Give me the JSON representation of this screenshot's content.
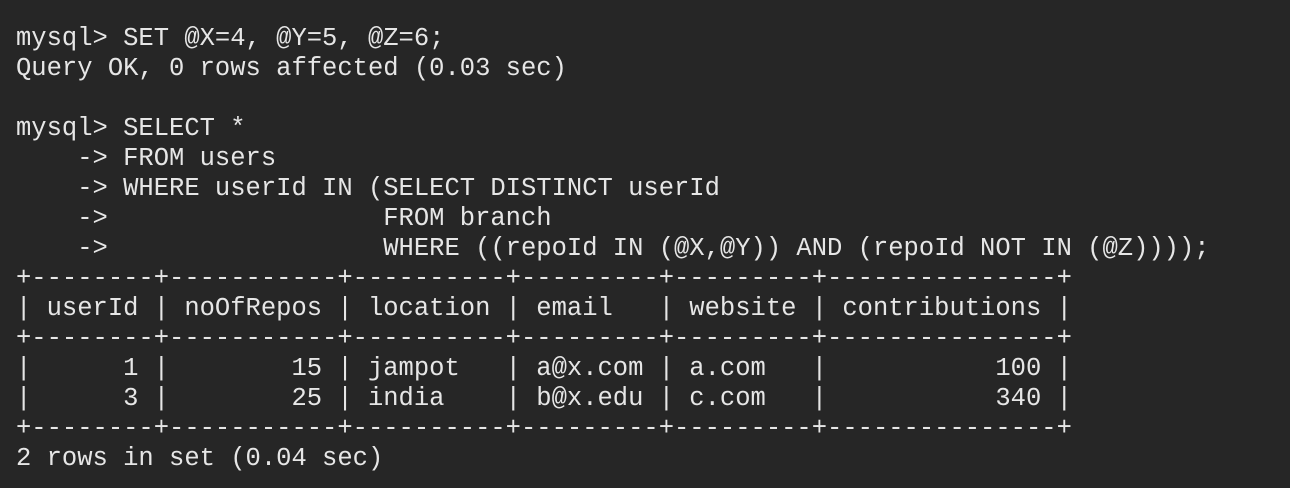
{
  "terminal": {
    "lines": [
      "mysql> SET @X=4, @Y=5, @Z=6;",
      "Query OK, 0 rows affected (0.03 sec)",
      "",
      "mysql> SELECT *",
      "    -> FROM users",
      "    -> WHERE userId IN (SELECT DISTINCT userId",
      "    ->                  FROM branch",
      "    ->                  WHERE ((repoId IN (@X,@Y)) AND (repoId NOT IN (@Z))));",
      "+--------+-----------+----------+---------+---------+---------------+",
      "| userId | noOfRepos | location | email   | website | contributions |",
      "+--------+-----------+----------+---------+---------+---------------+",
      "|      1 |        15 | jampot   | a@x.com | a.com   |           100 |",
      "|      3 |        25 | india    | b@x.edu | c.com   |           340 |",
      "+--------+-----------+----------+---------+---------+---------------+",
      "2 rows in set (0.04 sec)"
    ]
  }
}
